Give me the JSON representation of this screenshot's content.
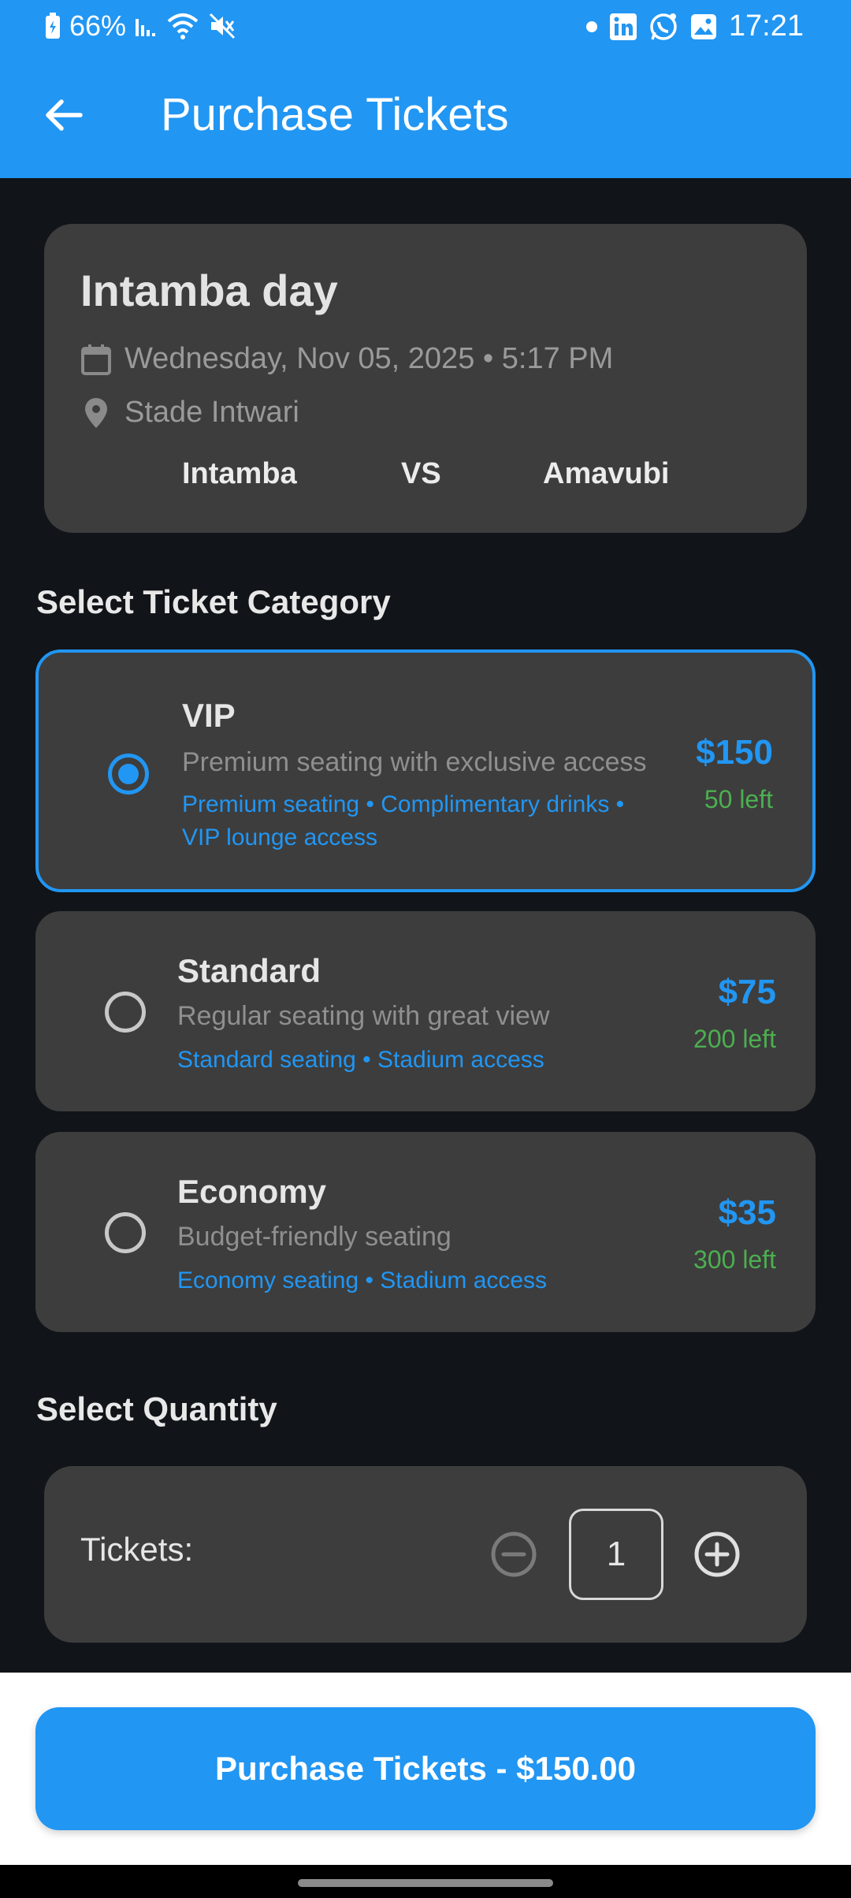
{
  "status_bar": {
    "battery": "66%",
    "time": "17:21"
  },
  "toolbar": {
    "title": "Purchase Tickets"
  },
  "event": {
    "title": "Intamba day",
    "datetime": "Wednesday, Nov 05, 2025 • 5:17 PM",
    "venue": "Stade Intwari",
    "team_home": "Intamba",
    "vs": "VS",
    "team_away": "Amavubi"
  },
  "category_section": {
    "title": "Select Ticket Category"
  },
  "tickets": [
    {
      "name": "VIP",
      "description": "Premium seating with exclusive access",
      "features_line1": "Premium seating • Complimentary drinks •",
      "features_line2": "VIP lounge access",
      "price": "$150",
      "remaining": "50 left",
      "selected": true
    },
    {
      "name": "Standard",
      "description": "Regular seating with great view",
      "features_line1": "Standard seating • Stadium access",
      "price": "$75",
      "remaining": "200 left",
      "selected": false
    },
    {
      "name": "Economy",
      "description": "Budget-friendly seating",
      "features_line1": "Economy seating • Stadium access",
      "price": "$35",
      "remaining": "300 left",
      "selected": false
    }
  ],
  "quantity_section": {
    "title": "Select Quantity",
    "label": "Tickets:",
    "value": "1"
  },
  "purchase": {
    "label": "Purchase Tickets - $150.00"
  },
  "colors": {
    "primary": "#2196f3",
    "success": "#4caf50",
    "card": "#3d3d3d",
    "background": "#111418"
  }
}
